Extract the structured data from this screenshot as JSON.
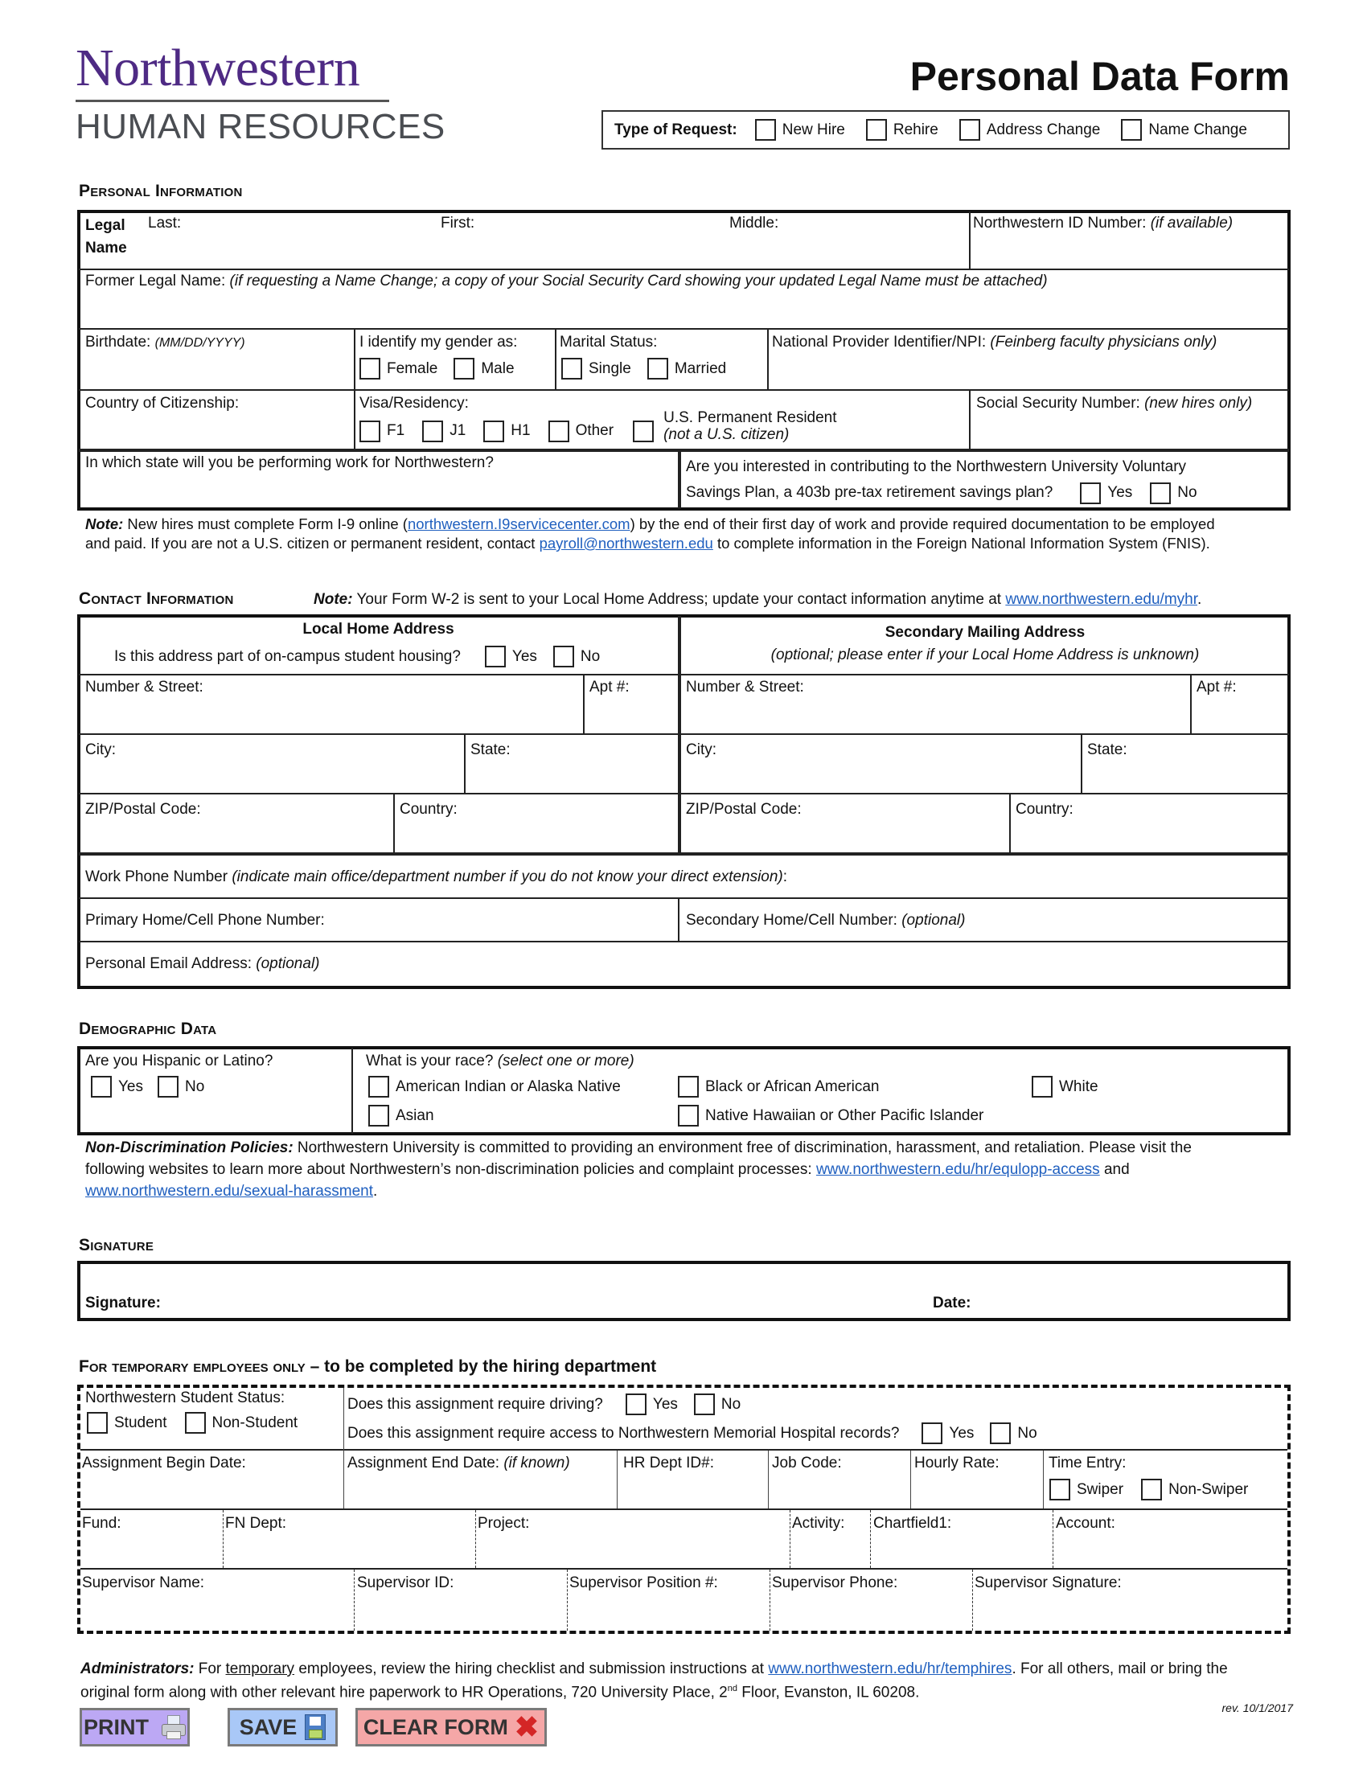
{
  "header": {
    "logo_line1": "Northwestern",
    "logo_line2": "HUMAN RESOURCES",
    "form_title": "Personal Data Form",
    "request_label": "Type of Request:",
    "request_options": [
      "New Hire",
      "Rehire",
      "Address Change",
      "Name Change"
    ]
  },
  "personal": {
    "title": "Personal Information",
    "legal_name_label": "Legal Name",
    "legal_name_line1": "Legal",
    "legal_name_line2": "Name",
    "last": "Last:",
    "first": "First:",
    "middle": "Middle:",
    "nu_id": "Northwestern ID Number:",
    "nu_id_hint": "(if available)",
    "former_name": "Former Legal Name:",
    "former_name_hint": "(if requesting a Name Change; a copy of your Social Security Card showing your updated Legal Name must be attached)",
    "birthdate": "Birthdate:",
    "birthdate_hint": "(MM/DD/YYYY)",
    "gender_label": "I identify my gender as:",
    "gender_options": [
      "Female",
      "Male"
    ],
    "marital_label": "Marital Status:",
    "marital_options": [
      "Single",
      "Married"
    ],
    "npi": "National Provider Identifier/NPI:",
    "npi_hint": "(Feinberg faculty physicians only)",
    "citizenship": "Country of Citizenship:",
    "visa_label": "Visa/Residency:",
    "visa_options": [
      "F1",
      "J1",
      "H1",
      "Other"
    ],
    "perm_resident": "U.S. Permanent Resident",
    "perm_resident_hint": "(not a U.S. citizen)",
    "ssn": "Social Security Number:",
    "ssn_hint": "(new hires only)",
    "work_state": "In which state will you be performing work for Northwestern?",
    "savings_line1": "Are you interested in contributing to the Northwestern University Voluntary",
    "savings_line2": "Savings Plan, a 403b pre-tax retirement savings plan?",
    "yes": "Yes",
    "no": "No"
  },
  "note1": {
    "prefix": "Note:",
    "text_a": " New hires must complete Form I-9 online (",
    "link1": "northwestern.I9servicecenter.com",
    "text_b": ") by the end of their first day of work and provide required documentation to be employed",
    "text_c": "and paid. If you are not a U.S. citizen or permanent resident, contact ",
    "link2": "payroll@northwestern.edu",
    "text_d": " to complete information in the Foreign National Information System (FNIS)."
  },
  "contact": {
    "title": "Contact Information",
    "note_prefix": "Note:",
    "note_text": " Your Form W-2 is sent to your Local Home Address; update your contact information anytime at ",
    "note_link": "www.northwestern.edu/myhr",
    "note_end": ".",
    "local_title": "Local Home Address",
    "housing_q": "Is this address part of on-campus student housing?",
    "secondary_title": "Secondary Mailing Address",
    "secondary_hint": "(optional; please enter if your Local Home Address is unknown)",
    "street": "Number & Street:",
    "apt": "Apt #:",
    "city": "City:",
    "state": "State:",
    "zip": "ZIP/Postal Code:",
    "country": "Country:",
    "work_phone": "Work Phone Number",
    "work_phone_hint": "(indicate main office/department number if you do not know your direct extension)",
    "work_phone_end": ":",
    "primary_phone": "Primary Home/Cell Phone Number:",
    "secondary_phone": "Secondary Home/Cell Number:",
    "optional": "(optional)",
    "email": "Personal Email Address:",
    "yes": "Yes",
    "no": "No"
  },
  "demographic": {
    "title": "Demographic Data",
    "hispanic_q": "Are you Hispanic or Latino?",
    "race_q": "What is your race?",
    "race_hint": "(select one or more)",
    "race_options": [
      "American Indian or Alaska Native",
      "Black or African American",
      "White",
      "Asian",
      "Native Hawaiian or Other Pacific Islander"
    ],
    "yes": "Yes",
    "no": "No"
  },
  "nondiscrimination": {
    "prefix": "Non-Discrimination Policies:",
    "text_a": "  Northwestern University is committed to providing an environment free of discrimination, harassment, and retaliation. Please visit the",
    "text_b": "following websites to learn more about Northwestern’s non-discrimination policies and complaint processes: ",
    "link1": "www.northwestern.edu/hr/equlopp-access",
    "text_c": " and",
    "link2": "www.northwestern.edu/sexual-harassment",
    "text_d": "."
  },
  "signature": {
    "title": "Signature",
    "signature_label": "Signature:",
    "date_label": "Date:"
  },
  "temp": {
    "title_caps": "For temporary employees only",
    "title_rest": " – to be completed by the hiring department",
    "student_status": "Northwestern Student Status:",
    "student_options": [
      "Student",
      "Non-Student"
    ],
    "driving_q": "Does this assignment require driving?",
    "hospital_q": "Does this assignment require access to Northwestern Memorial Hospital records?",
    "yes": "Yes",
    "no": "No",
    "begin_date": "Assignment Begin Date:",
    "end_date": "Assignment End Date:",
    "end_date_hint": "(if known)",
    "hr_dept": "HR Dept ID#:",
    "job_code": "Job Code:",
    "hourly_rate": "Hourly Rate:",
    "time_entry": "Time Entry:",
    "time_options": [
      "Swiper",
      "Non-Swiper"
    ],
    "fund": "Fund:",
    "fn_dept": "FN Dept:",
    "project": "Project:",
    "activity": "Activity:",
    "chartfield": "Chartfield1:",
    "account": "Account:",
    "sup_name": "Supervisor Name:",
    "sup_id": "Supervisor ID:",
    "sup_position": "Supervisor Position #:",
    "sup_phone": "Supervisor Phone:",
    "sup_signature": "Supervisor Signature:"
  },
  "admin": {
    "prefix": "Administrators:",
    "text_a": " For ",
    "temporary": "temporary",
    "text_b": " employees, review the hiring checklist and submission instructions at ",
    "link": "www.northwestern.edu/hr/temphires",
    "text_c": ".  For all others, mail or bring the",
    "text_d": "original form along with other relevant hire paperwork to HR Operations, 720 University Place, 2",
    "sup": "nd",
    "text_e": " Floor, Evanston, IL 60208.",
    "revision": "rev. 10/1/2017"
  },
  "buttons": {
    "print": "PRINT",
    "save": "SAVE",
    "clear": "CLEAR FORM",
    "print_color": "#bca8f4",
    "save_color": "#a9c8f7",
    "clear_color": "#f5a7a7"
  },
  "colors": {
    "brand_purple": "#4e2a84",
    "gray_text": "#4a4d52",
    "link_blue": "#1f5fbf"
  }
}
